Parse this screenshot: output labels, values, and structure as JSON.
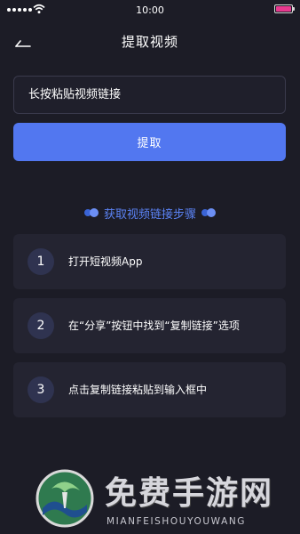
{
  "status_bar": {
    "time": "10:00",
    "battery_color": "#e8398f"
  },
  "header": {
    "back_icon": "back-arrow-icon",
    "title": "提取视频"
  },
  "link_input": {
    "placeholder": "长按粘贴视频链接",
    "value": ""
  },
  "extract_button": {
    "label": "提取",
    "color": "#5277f0"
  },
  "steps": {
    "heading": "获取视频链接步骤",
    "items": [
      {
        "number": "1",
        "text": "打开短视频App"
      },
      {
        "number": "2",
        "text": "在“分享”按钮中找到“复制链接”选项"
      },
      {
        "number": "3",
        "text": "点击复制链接粘贴到输入框中"
      }
    ]
  },
  "watermark": {
    "title": "免费手游网",
    "subtitle": "MIANFEISHOUYOUWANG"
  },
  "colors": {
    "background": "#1c1c26",
    "card": "#242431",
    "accent": "#5b83f5"
  }
}
